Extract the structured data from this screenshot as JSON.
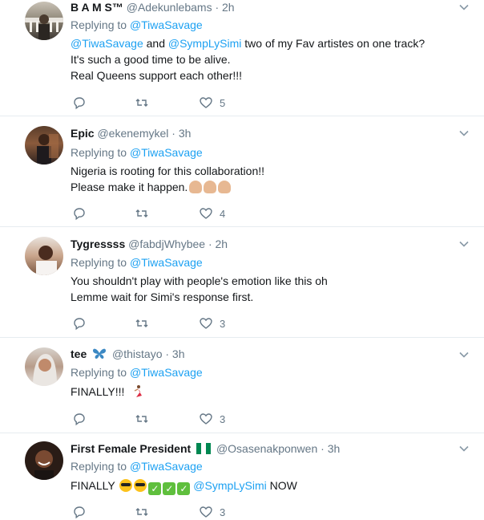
{
  "colors": {
    "accent": "#1da1f2",
    "muted": "#657786",
    "text": "#14171a",
    "divider": "#e6ecf0"
  },
  "tweets": [
    {
      "name": "B A M S™",
      "handle": "@Adekunlebams",
      "time": "· 2h",
      "replying_prefix": "Replying to ",
      "replying_to": "@TiwaSavage",
      "line1_mention_a": "@TiwaSavage",
      "line1_and": " and ",
      "line1_mention_b": "@SympLySimi",
      "line1_rest": " two of my Fav artistes on one track?",
      "line2": "It's such a good time to be alive.",
      "line3": "Real Queens support each other!!!",
      "likes": "5"
    },
    {
      "name": "Epic",
      "handle": "@ekenemykel",
      "time": "· 3h",
      "replying_prefix": "Replying to ",
      "replying_to": "@TiwaSavage",
      "line1": "Nigeria is rooting for this collaboration!!",
      "line2": "Please make it happen.",
      "likes": "4"
    },
    {
      "name": "Tygressss",
      "handle": "@fabdjWhybee",
      "time": "· 2h",
      "replying_prefix": "Replying to ",
      "replying_to": "@TiwaSavage",
      "line1": "You shouldn't play with people's emotion like this oh",
      "line2": "Lemme wait for Simi's response first.",
      "likes": "3"
    },
    {
      "name": "tee",
      "handle": "@thistayo",
      "time": "· 3h",
      "replying_prefix": "Replying to ",
      "replying_to": "@TiwaSavage",
      "line1": "FINALLY!!!",
      "likes": "3"
    },
    {
      "name": "First Female President",
      "handle": "@Osasenakponwen",
      "time": "· 3h",
      "replying_prefix": "Replying to ",
      "replying_to": "@TiwaSavage",
      "line1_a": "FINALLY",
      "line1_mention": "@SympLySimi",
      "line1_b": " NOW",
      "likes": "3"
    }
  ]
}
